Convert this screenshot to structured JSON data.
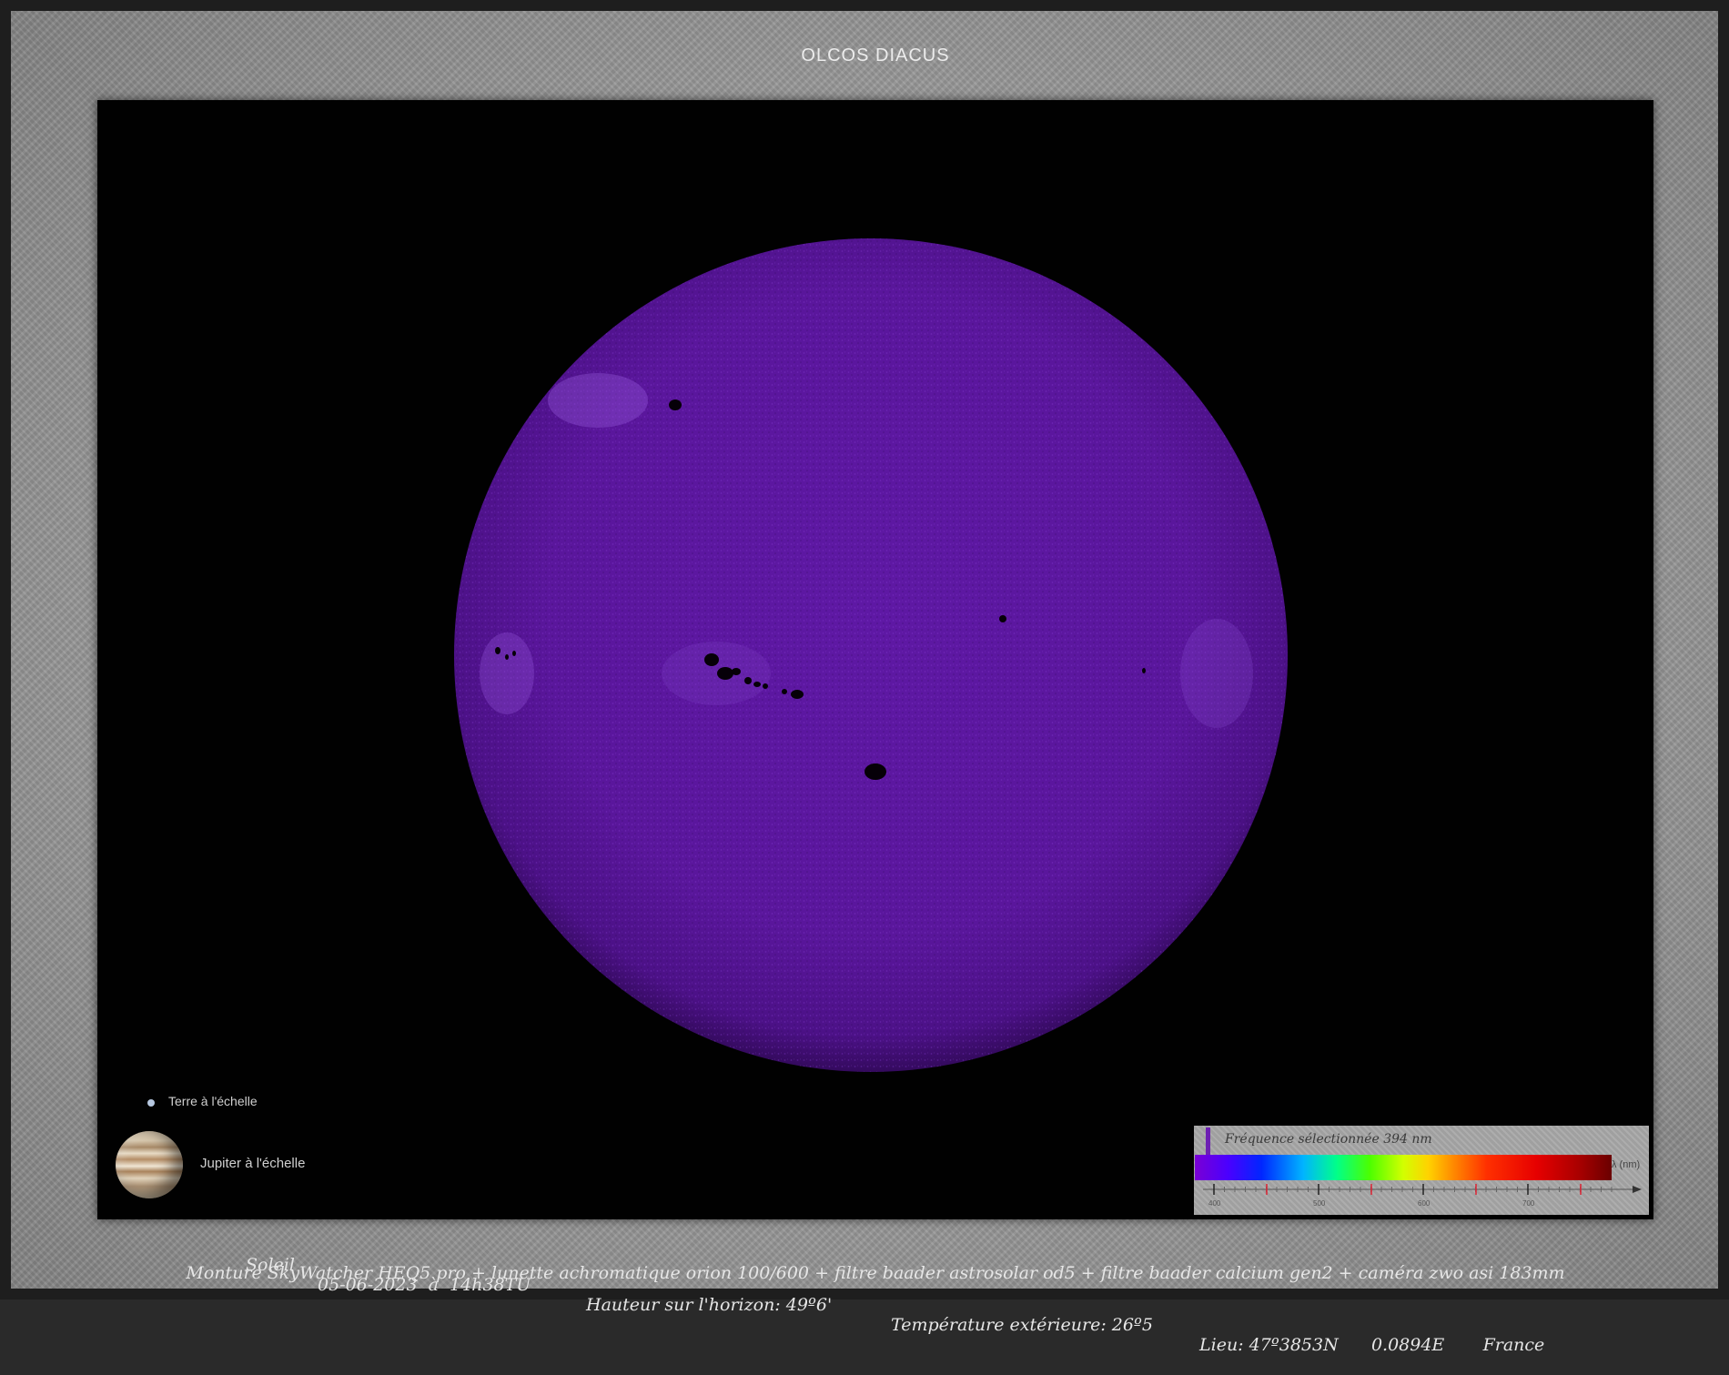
{
  "title": "OLCOS DIACUS",
  "legend": {
    "earth_label": "Terre à l'échelle",
    "jupiter_label": "Jupiter à l'échelle"
  },
  "spectrum": {
    "frequency_label": "Fréquence sélectionnée 394 nm",
    "axis_label": "λ (nm)",
    "ticks": [
      "400",
      "500",
      "600",
      "700"
    ]
  },
  "caption": {
    "object": "Soleil",
    "datetime": "05-06-2023  à  14h38TU",
    "altitude": "Hauteur sur l'horizon: 49º6'",
    "temperature": "Température extérieure: 26º5",
    "location": "Lieu: 47º3853N      0.0894E       France",
    "equipment": "Monture SkyWatcher HEQ5 pro +  lunette achromatique orion 100/600 + filtre baader astrosolar od5 + filtre baader calcium gen2 + caméra zwo asi 183mm"
  },
  "colors": {
    "sun": "#5a169c",
    "sun_spots": "#060008",
    "frame": "#a3a3a3",
    "background": "#010101"
  }
}
